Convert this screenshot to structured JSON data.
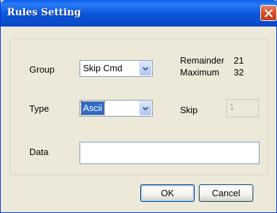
{
  "window": {
    "title": "Rules Setting"
  },
  "form": {
    "group": {
      "label": "Group",
      "selected": "Skip Cmd"
    },
    "type": {
      "label": "Type",
      "selected": "Ascii"
    },
    "remainder": {
      "label": "Remainder",
      "value": "21"
    },
    "maximum": {
      "label": "Maximum",
      "value": "32"
    },
    "skip": {
      "label": "Skip",
      "value": "1"
    },
    "data": {
      "label": "Data",
      "value": ""
    }
  },
  "buttons": {
    "ok": "OK",
    "cancel": "Cancel"
  },
  "icons": {
    "close": "close-icon",
    "dropdown": "chevron-down-icon"
  },
  "colors": {
    "titlebar": "#0a55d8",
    "close": "#d8532c",
    "selection": "#316ac5",
    "dialog": "#ece9d8"
  }
}
